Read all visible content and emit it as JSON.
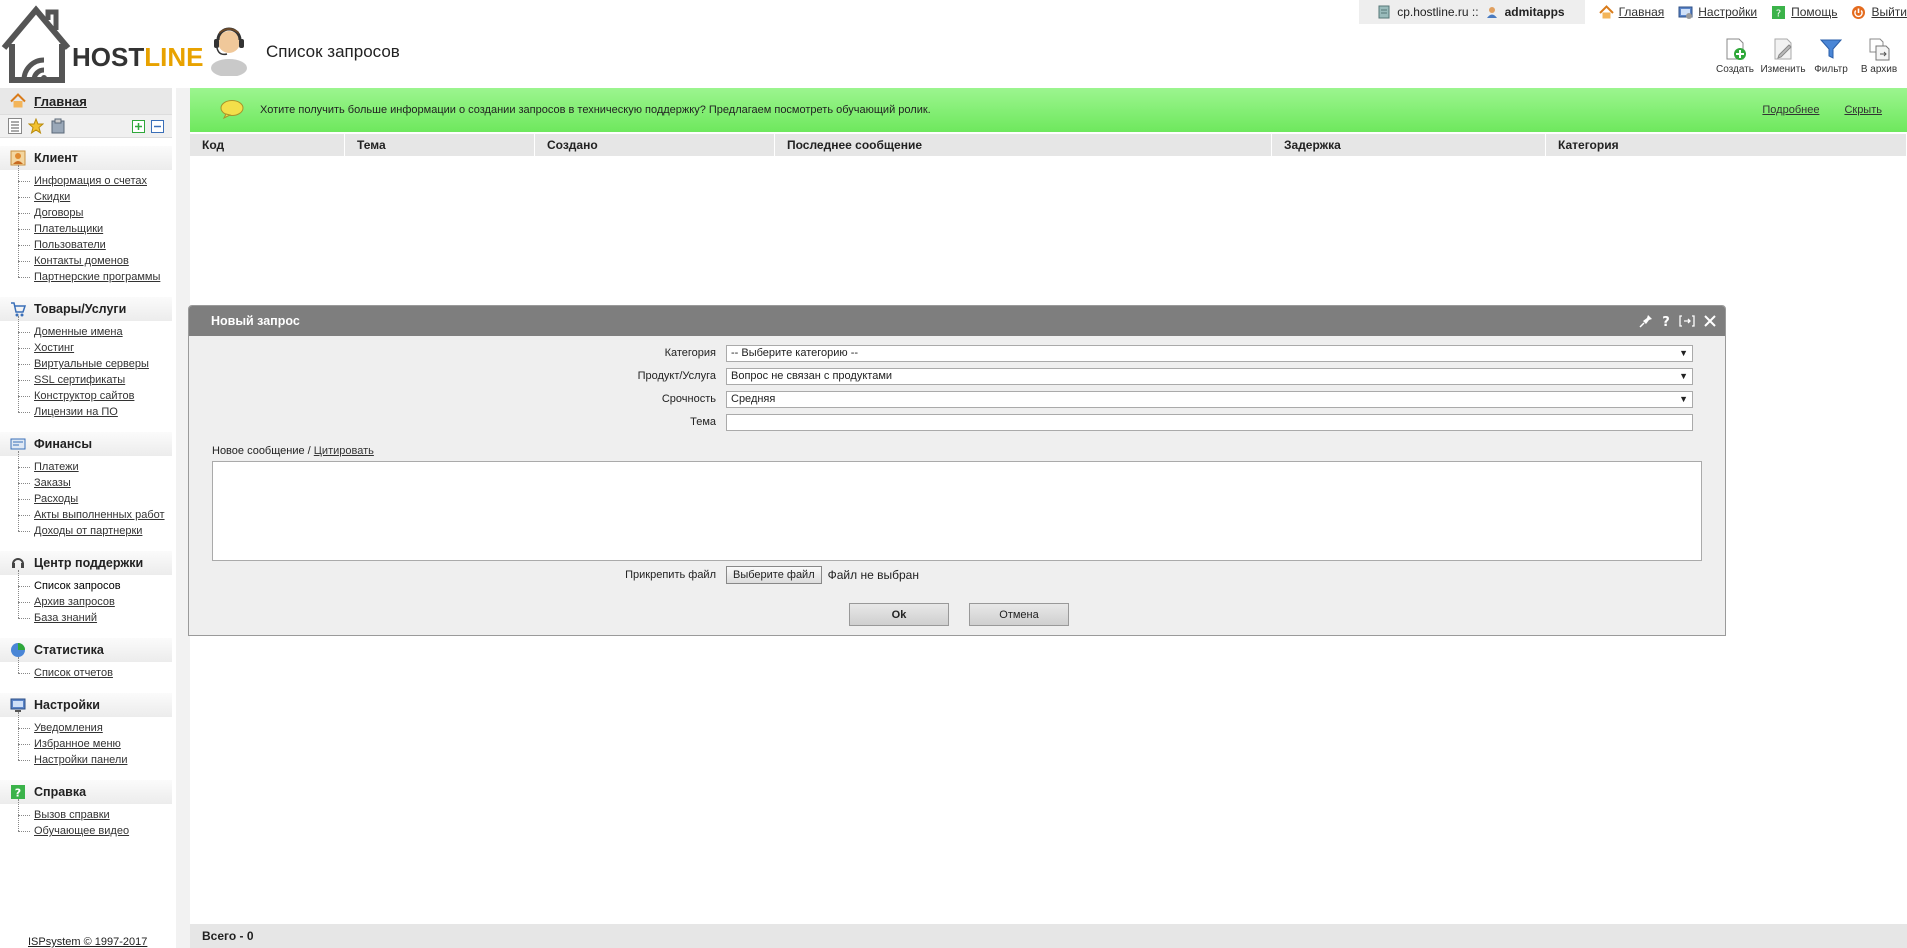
{
  "header": {
    "logo_part1": "HOST",
    "logo_part2": "LINE",
    "page_title": "Список запросов",
    "host": "cp.hostline.ru ::",
    "user": "admitapps",
    "links": [
      {
        "label": "Главная",
        "icon": "home-icon"
      },
      {
        "label": "Настройки",
        "icon": "settings-icon"
      },
      {
        "label": "Помощь",
        "icon": "help-icon"
      },
      {
        "label": "Выйти",
        "icon": "logout-icon"
      }
    ],
    "toolbar": [
      {
        "label": "Создать",
        "icon": "create-icon"
      },
      {
        "label": "Изменить",
        "icon": "edit-icon"
      },
      {
        "label": "Фильтр",
        "icon": "filter-icon"
      },
      {
        "label": "В архив",
        "icon": "archive-icon"
      }
    ]
  },
  "sidebar": {
    "home": "Главная",
    "groups": [
      {
        "title": "Клиент",
        "icon": "client-icon",
        "items": [
          "Информация о счетах",
          "Скидки",
          "Договоры",
          "Плательщики",
          "Пользователи",
          "Контакты доменов",
          "Партнерские программы"
        ]
      },
      {
        "title": "Товары/Услуги",
        "icon": "cart-icon",
        "items": [
          "Доменные имена",
          "Хостинг",
          "Виртуальные серверы",
          "SSL сертификаты",
          "Конструктор сайтов",
          "Лицензии на ПО"
        ]
      },
      {
        "title": "Финансы",
        "icon": "finance-icon",
        "items": [
          "Платежи",
          "Заказы",
          "Расходы",
          "Акты выполненных работ",
          "Доходы от партнерки"
        ]
      },
      {
        "title": "Центр поддержки",
        "icon": "support-icon",
        "items": [
          "Список запросов",
          "Архив запросов",
          "База знаний"
        ]
      },
      {
        "title": "Статистика",
        "icon": "stats-icon",
        "items": [
          "Список отчетов"
        ]
      },
      {
        "title": "Настройки",
        "icon": "settings-icon",
        "items": [
          "Уведомления",
          "Избранное меню",
          "Настройки панели"
        ]
      },
      {
        "title": "Справка",
        "icon": "help-icon",
        "items": [
          "Вызов справки",
          "Обучающее видео"
        ]
      }
    ],
    "footer": "ISPsystem © 1997-2017"
  },
  "banner": {
    "message": "Хотите получить больше информации о создании запросов в техническую поддержку? Предлагаем посмотреть обучающий ролик.",
    "more": "Подробнее",
    "hide": "Скрыть"
  },
  "grid": {
    "columns": [
      "Код",
      "Тема",
      "Создано",
      "Последнее сообщение",
      "Задержка",
      "Категория"
    ],
    "total": "Всего - 0"
  },
  "dialog": {
    "title": "Новый запрос",
    "fields": {
      "category_label": "Категория",
      "category_value": "-- Выберите категорию --",
      "product_label": "Продукт/Услуга",
      "product_value": "Вопрос не связан с продуктами",
      "urgency_label": "Срочность",
      "urgency_value": "Средняя",
      "subject_label": "Тема",
      "subject_value": ""
    },
    "message_label": "Новое сообщение /",
    "quote": "Цитировать",
    "attach_label": "Прикрепить файл",
    "choose_file": "Выберите файл",
    "no_file": "Файл не выбран",
    "ok": "Ok",
    "cancel": "Отмена"
  }
}
